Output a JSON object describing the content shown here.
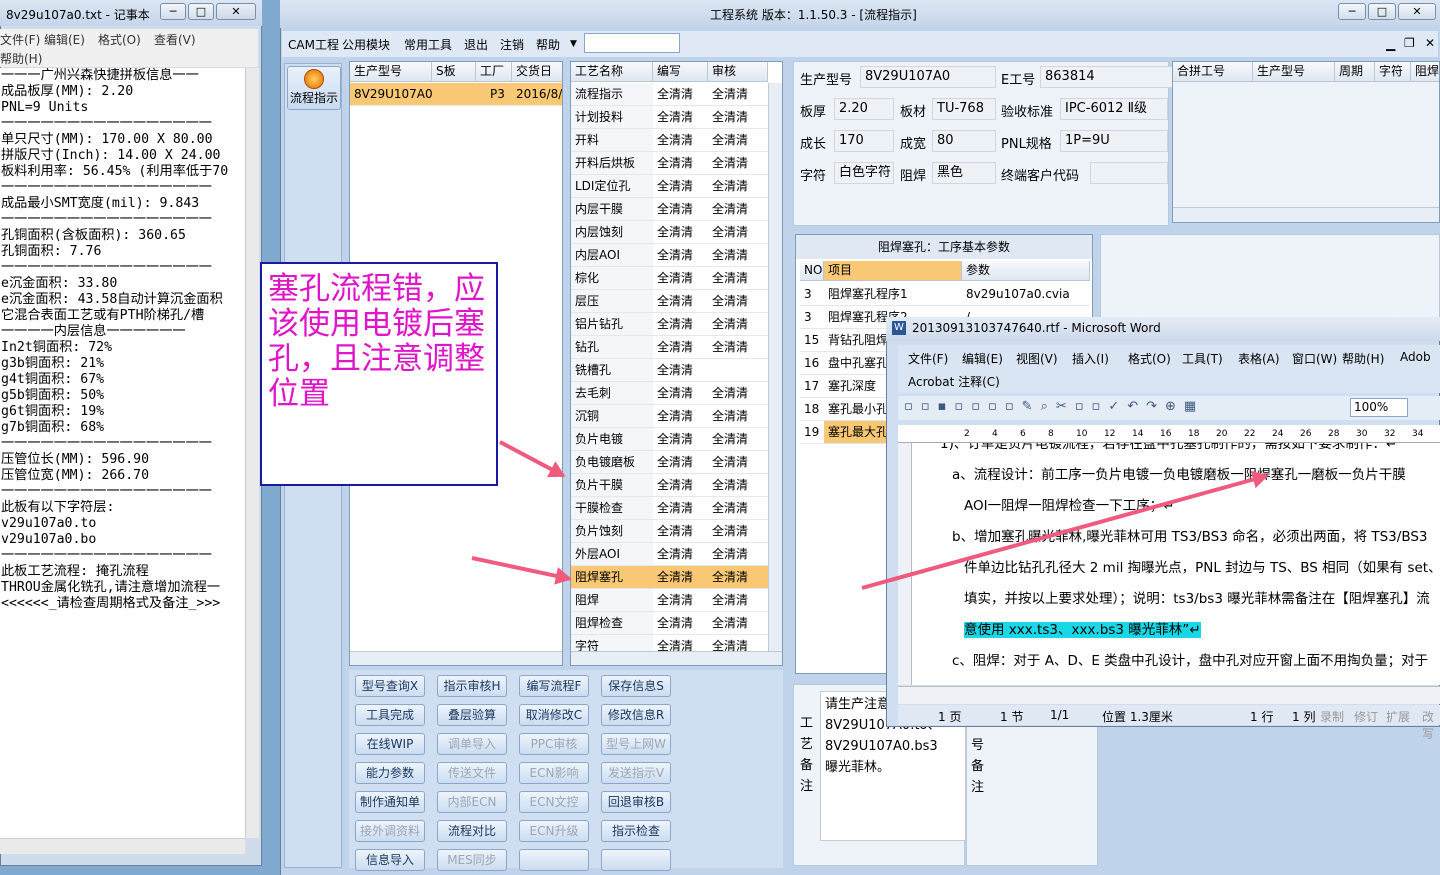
{
  "notepad": {
    "title": "8v29u107a0.txt - 记事本",
    "menu": [
      "文件(F)",
      "编辑(E)",
      "格式(O)",
      "查看(V)"
    ],
    "menu2": "帮助(H)",
    "lines": [
      "一一一广州兴森快捷拼板信息一一",
      "成品板厚(MM): 2.20",
      "PNL=9 Units",
      "一一一一一一一一一一一一一一一一",
      "单只尺寸(MM): 170.00 X 80.00",
      "拼版尺寸(Inch): 14.00 X 24.00",
      "板料利用率: 56.45% (利用率低于70",
      "一一一一一一一一一一一一一一一一",
      "成品最小SMT宽度(mil): 9.843",
      "一一一一一一一一一一一一一一一一",
      "孔铜面积(含板面积): 360.65",
      "孔铜面积: 7.76",
      "一一一一一一一一一一一一一一一一",
      "e沉金面积: 33.80",
      "e沉金面积: 43.58自动计算沉金面积",
      "它混合表面工艺或有PTH阶梯孔/槽",
      "一一一一内层信息一一一一一一",
      "In2t铜面积: 72%",
      "g3b铜面积: 21%",
      "g4t铜面积: 67%",
      "g5b铜面积: 50%",
      "g6t铜面积: 19%",
      "g7b铜面积: 68%",
      "一一一一一一一一一一一一一一一一",
      "压管位长(MM): 596.90",
      "压管位宽(MM): 266.70",
      "一一一一一一一一一一一一一一一一",
      "此板有以下字符层:",
      "v29u107a0.to",
      "v29u107a0.bo",
      "一一一一一一一一一一一一一一一一",
      "此板工艺流程: 掩孔流程",
      "THROU金属化铣孔,请注意增加流程一",
      "<<<<<<_请检查周期格式及备注_>>>"
    ]
  },
  "app": {
    "title": "工程系统  版本：1.1.50.3 - [流程指示]",
    "menu": [
      "CAM工程",
      "公用模块",
      "常用工具",
      "退出",
      "注销",
      "帮助"
    ],
    "side_button": "流程指示",
    "order_grid": {
      "headers": [
        "生产型号",
        "S板",
        "工厂",
        "交货日期"
      ],
      "row": [
        "8V29U107A0",
        "",
        "P3",
        "2016/8/"
      ]
    },
    "process_grid": {
      "headers": [
        "工艺名称",
        "编写",
        "审核"
      ],
      "rows": [
        [
          "流程指示",
          "全清清",
          "全清清"
        ],
        [
          "计划投料",
          "全清清",
          "全清清"
        ],
        [
          "开料",
          "全清清",
          "全清清"
        ],
        [
          "开料后烘板",
          "全清清",
          "全清清"
        ],
        [
          "LDI定位孔",
          "全清清",
          "全清清"
        ],
        [
          "内层干膜",
          "全清清",
          "全清清"
        ],
        [
          "内层蚀刻",
          "全清清",
          "全清清"
        ],
        [
          "内层AOI",
          "全清清",
          "全清清"
        ],
        [
          "棕化",
          "全清清",
          "全清清"
        ],
        [
          "层压",
          "全清清",
          "全清清"
        ],
        [
          "铝片钻孔",
          "全清清",
          "全清清"
        ],
        [
          "钻孔",
          "全清清",
          "全清清"
        ],
        [
          "铣槽孔",
          "全清清",
          ""
        ],
        [
          "去毛刺",
          "全清清",
          "全清清"
        ],
        [
          "沉铜",
          "全清清",
          "全清清"
        ],
        [
          "负片电镀",
          "全清清",
          "全清清"
        ],
        [
          "负电镀磨板",
          "全清清",
          "全清清"
        ],
        [
          "负片干膜",
          "全清清",
          "全清清"
        ],
        [
          "干膜检查",
          "全清清",
          "全清清"
        ],
        [
          "负片蚀刻",
          "全清清",
          "全清清"
        ],
        [
          "外层AOI",
          "全清清",
          "全清清"
        ],
        [
          "阻焊塞孔",
          "全清清",
          "全清清"
        ],
        [
          "阻焊",
          "全清清",
          "全清清"
        ],
        [
          "阻焊检查",
          "全清清",
          "全清清"
        ],
        [
          "字符",
          "全清清",
          "全清清"
        ]
      ]
    },
    "info": {
      "生产型号": "8V29U107A0",
      "E工号": "863814",
      "板厚": "2.20",
      "板材": "TU-768",
      "验收标准": "IPC-6012 Ⅱ级",
      "成长": "170",
      "成宽": "80",
      "PNL规格": "1P=9U",
      "字符": "白色字符",
      "阻焊": "黑色",
      "终端客户代码": ""
    },
    "info_labels": [
      "生产型号",
      "E工号",
      "板厚",
      "板材",
      "验收标准",
      "成长",
      "成宽",
      "PNL规格",
      "字符",
      "阻焊",
      "终端客户代码"
    ],
    "merge_headers": [
      "合拼工号",
      "生产型号",
      "周期",
      "字符",
      "阻焊"
    ],
    "param_panel": {
      "title": "阻焊塞孔：工序基本参数",
      "headers": [
        "NO",
        "项目",
        "参数"
      ],
      "rows": [
        [
          "3",
          "阻焊塞孔程序1",
          "8v29u107a0.cvia"
        ],
        [
          "3",
          "阻焊塞孔程序2",
          "/"
        ],
        [
          "15",
          "背钻孔阻焊",
          ""
        ],
        [
          "16",
          "盘中孔塞孔",
          ""
        ],
        [
          "17",
          "塞孔深度",
          ""
        ],
        [
          "18",
          "塞孔最小孔",
          ""
        ],
        [
          "19",
          "塞孔最大孔",
          ""
        ]
      ]
    },
    "remark": {
      "label1": "工艺备注",
      "text": "请生产注意\n8V29U107A0.to、\n8V29U107A0.bs3\n曝光菲林。",
      "label2": "号备注"
    },
    "buttons": [
      [
        "型号查询X",
        "指示审核H",
        "编写流程F",
        "保存信息S"
      ],
      [
        "工具完成",
        "叠层验算",
        "取消修改C",
        "修改信息R"
      ],
      [
        "在线WIP",
        "调单导入",
        "PPC审核",
        "型号上网W"
      ],
      [
        "能力参数",
        "传送文件",
        "ECN影响",
        "发送指示V"
      ],
      [
        "制作通知单",
        "内部ECN",
        "ECN文控",
        "回退审核B"
      ],
      [
        "接外调资料",
        "流程对比",
        "ECN升级",
        "指示检查"
      ],
      [
        "信息导入",
        "MES同步",
        "",
        ""
      ]
    ],
    "disabled": [
      "调单导入",
      "PPC审核",
      "型号上网W",
      "传送文件",
      "ECN影响",
      "发送指示V",
      "内部ECN",
      "ECN文控",
      "接外调资料",
      "ECN升级",
      "MES同步"
    ]
  },
  "annotation": "塞孔流程错，应该使用电镀后塞孔，且注意调整位置",
  "word": {
    "title": "20130913103747640.rtf - Microsoft Word",
    "menu": [
      "文件(F)",
      "编辑(E)",
      "视图(V)",
      "插入(I)",
      "格式(O)",
      "工具(T)",
      "表格(A)",
      "窗口(W)",
      "帮助(H)",
      "Adob"
    ],
    "menu2": "Acrobat 注释(C)",
    "zoom": "100%",
    "ruler": [
      "2",
      "4",
      "6",
      "8",
      "10",
      "12",
      "14",
      "16",
      "18",
      "20",
      "22",
      "24",
      "26",
      "28",
      "30",
      "32",
      "34"
    ],
    "lines": [
      "1)、订单是负片电镀流程，若存在盘中孔塞孔制作的，需按如下要求制作：↵",
      "a、流程设计：前工序一负片电镀一负电镀磨板一阻焊塞孔一磨板一负片干膜",
      "AOI一阻焊一阻焊检查一下工序；↵",
      "b、增加塞孔曝光菲林,曝光菲林可用 TS3/BS3 命名，必须出两面，将 TS3/BS3",
      "件单边比钻孔孔径大 2 mil 掏曝光点，PNL 封边与 TS、BS 相同（如果有 set、c",
      "填实，并按以上要求处理）；说明：ts3/bs3 曝光菲林需备注在【阻焊塞孔】流",
      "意使用 xxx.ts3、xxx.bs3 曝光菲林”↵",
      "c、阻焊：对于 A、D、E 类盘中孔设计，盘中孔对应开窗上面不用掏负量；对于"
    ],
    "status": [
      "1 页",
      "1 节",
      "1/1",
      "位置 1.3厘米",
      "1 行",
      "1 列",
      "录制",
      "修订",
      "扩展",
      "改写"
    ]
  }
}
